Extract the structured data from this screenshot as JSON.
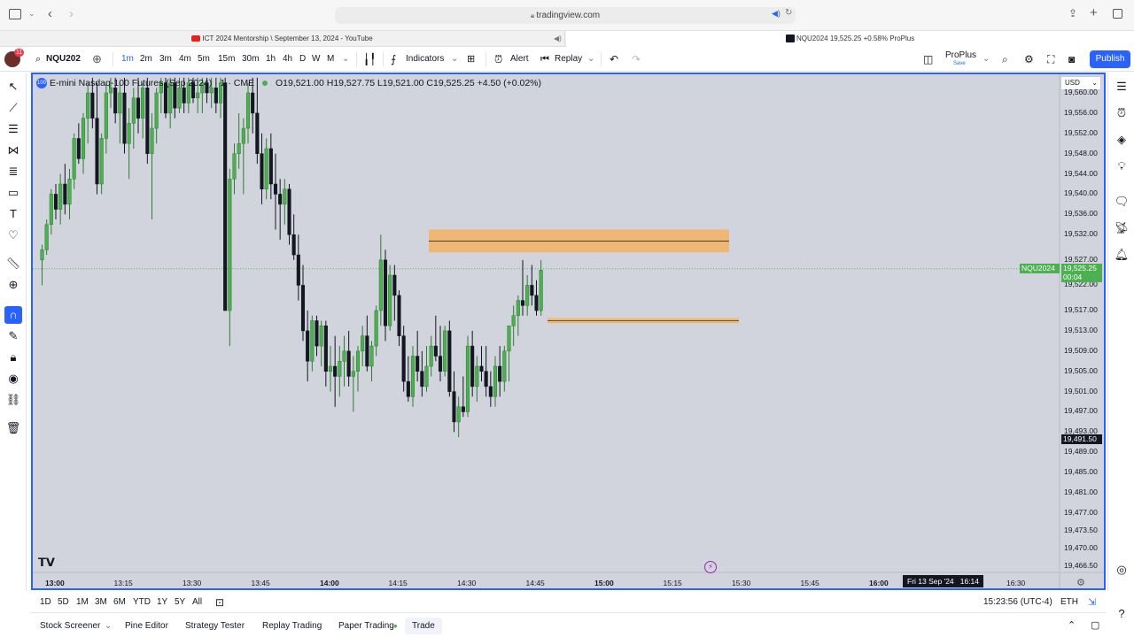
{
  "browser": {
    "url": "tradingview.com",
    "tabs": [
      {
        "label": "ICT 2024 Mentorship \\ September 13, 2024 - YouTube"
      },
      {
        "label": "NQU2024 19,525.25 +0.58% ProPlus"
      }
    ]
  },
  "toolbar": {
    "symbol": "NQU202",
    "avatar_badge": "11",
    "intervals": [
      "1m",
      "2m",
      "3m",
      "4m",
      "5m",
      "15m",
      "30m",
      "1h",
      "4h",
      "D",
      "W",
      "M"
    ],
    "indicators_label": "Indicators",
    "alert_label": "Alert",
    "replay_label": "Replay",
    "plan_label": "ProPlus",
    "plan_sub": "Save",
    "publish_label": "Publish"
  },
  "legend": {
    "title": "E-mini Nasdaq-100 Futures (Sep 2024) · 1 · CME",
    "ohlc": "O19,521.00 H19,527.75 L19,521.00 C19,525.25 +4.50 (+0.02%)"
  },
  "price_axis": {
    "currency": "USD",
    "ticks": [
      "19,560.00",
      "19,556.00",
      "19,552.00",
      "19,548.00",
      "19,544.00",
      "19,540.00",
      "19,536.00",
      "19,532.00",
      "19,527.00",
      "19,522.00",
      "19,517.00",
      "19,513.00",
      "19,509.00",
      "19,505.00",
      "19,501.00",
      "19,497.00",
      "19,493.00",
      "19,489.00",
      "19,485.00",
      "19,481.00",
      "19,477.00",
      "19,473.50",
      "19,470.00",
      "19,466.50"
    ],
    "symbol_tag": "NQU2024",
    "last_price": "19,525.25",
    "countdown": "00:04",
    "crosshair_price": "19,491.50"
  },
  "time_axis": {
    "ticks": [
      "13:00",
      "13:15",
      "13:30",
      "13:45",
      "14:00",
      "14:15",
      "14:30",
      "14:45",
      "15:00",
      "15:15",
      "15:30",
      "15:45",
      "16:00",
      "16:30"
    ],
    "crosshair_time": "Fri 13 Sep '24   16:14"
  },
  "ranges": {
    "items": [
      "1D",
      "5D",
      "1M",
      "3M",
      "6M",
      "YTD",
      "1Y",
      "5Y",
      "All"
    ],
    "clock": "15:23:56 (UTC-4)",
    "session": "ETH"
  },
  "panels": {
    "items": [
      "Stock Screener",
      "Pine Editor",
      "Strategy Tester",
      "Replay Trading",
      "Paper Trading",
      "Trade"
    ]
  },
  "colors": {
    "up": "#4caf50",
    "down": "#131722",
    "zone": "#f5b162",
    "accent": "#2962ff"
  },
  "chart_data": {
    "type": "candlestick",
    "symbol": "NQU2024",
    "interval": "1",
    "zones": [
      {
        "from": 19528.5,
        "to": 19533.0
      },
      {
        "from": 19514.5,
        "to": 19515.5
      }
    ],
    "candles": [
      [
        19527,
        19530,
        19522,
        19529
      ],
      [
        19529,
        19535,
        19528,
        19534
      ],
      [
        19534,
        19541,
        19532,
        19540
      ],
      [
        19540,
        19542,
        19535,
        19537
      ],
      [
        19537,
        19544,
        19534,
        19542
      ],
      [
        19542,
        19546,
        19536,
        19538
      ],
      [
        19538,
        19545,
        19535,
        19543
      ],
      [
        19543,
        19552,
        19541,
        19551
      ],
      [
        19551,
        19554,
        19546,
        19547
      ],
      [
        19547,
        19556,
        19544,
        19555
      ],
      [
        19555,
        19562,
        19550,
        19560
      ],
      [
        19560,
        19563,
        19553,
        19555
      ],
      [
        19555,
        19562,
        19540,
        19542
      ],
      [
        19542,
        19552,
        19540,
        19551
      ],
      [
        19551,
        19562,
        19548,
        19560
      ],
      [
        19560,
        19563,
        19557,
        19561
      ],
      [
        19561,
        19563,
        19554,
        19556
      ],
      [
        19556,
        19562,
        19550,
        19560
      ],
      [
        19560,
        19563,
        19548,
        19550
      ],
      [
        19550,
        19557,
        19543,
        19554
      ],
      [
        19554,
        19561,
        19549,
        19559
      ],
      [
        19559,
        19563,
        19552,
        19555
      ],
      [
        19555,
        19562,
        19551,
        19561
      ],
      [
        19561,
        19563,
        19546,
        19548
      ],
      [
        19548,
        19556,
        19535,
        19553
      ],
      [
        19553,
        19561,
        19550,
        19560
      ],
      [
        19560,
        19563,
        19556,
        19562
      ],
      [
        19562,
        19563,
        19555,
        19556
      ],
      [
        19556,
        19563,
        19553,
        19562
      ],
      [
        19562,
        19563,
        19555,
        19557
      ],
      [
        19557,
        19563,
        19556,
        19561
      ],
      [
        19561,
        19563,
        19556,
        19558
      ],
      [
        19558,
        19563,
        19556,
        19562
      ],
      [
        19562,
        19563,
        19558,
        19559
      ],
      [
        19559,
        19563,
        19556,
        19560
      ],
      [
        19560,
        19563,
        19556,
        19562
      ],
      [
        19562,
        19563,
        19558,
        19560
      ],
      [
        19560,
        19563,
        19557,
        19561
      ],
      [
        19561,
        19563,
        19556,
        19558
      ],
      [
        19558,
        19563,
        19555,
        19562
      ],
      [
        19562,
        19563,
        19546,
        19517
      ],
      [
        19517,
        19545,
        19510,
        19543
      ],
      [
        19543,
        19550,
        19540,
        19548
      ],
      [
        19548,
        19556,
        19545,
        19550
      ],
      [
        19550,
        19555,
        19540,
        19553
      ],
      [
        19553,
        19562,
        19550,
        19560
      ],
      [
        19560,
        19563,
        19552,
        19556
      ],
      [
        19556,
        19563,
        19546,
        19548
      ],
      [
        19548,
        19552,
        19538,
        19541
      ],
      [
        19541,
        19551,
        19539,
        19549
      ],
      [
        19549,
        19552,
        19539,
        19542
      ],
      [
        19542,
        19548,
        19533,
        19540
      ],
      [
        19540,
        19543,
        19531,
        19538
      ],
      [
        19538,
        19543,
        19534,
        19541
      ],
      [
        19541,
        19542,
        19530,
        19532
      ],
      [
        19532,
        19536,
        19527,
        19528
      ],
      [
        19528,
        19532,
        19519,
        19522
      ],
      [
        19522,
        19526,
        19511,
        19513
      ],
      [
        19513,
        19517,
        19503,
        19507
      ],
      [
        19507,
        19516,
        19505,
        19515
      ],
      [
        19515,
        19516,
        19508,
        19510
      ],
      [
        19510,
        19515,
        19506,
        19514
      ],
      [
        19514,
        19515,
        19502,
        19505
      ],
      [
        19505,
        19510,
        19501,
        19506
      ],
      [
        19506,
        19512,
        19498,
        19504
      ],
      [
        19504,
        19510,
        19500,
        19507
      ],
      [
        19507,
        19512,
        19502,
        19509
      ],
      [
        19509,
        19513,
        19502,
        19504
      ],
      [
        19504,
        19508,
        19497,
        19505
      ],
      [
        19505,
        19510,
        19501,
        19509
      ],
      [
        19509,
        19514,
        19506,
        19512
      ],
      [
        19512,
        19516,
        19505,
        19506
      ],
      [
        19506,
        19511,
        19503,
        19510
      ],
      [
        19510,
        19518,
        19508,
        19517
      ],
      [
        19517,
        19532,
        19514,
        19527
      ],
      [
        19527,
        19529,
        19511,
        19514
      ],
      [
        19514,
        19526,
        19513,
        19524
      ],
      [
        19524,
        19526,
        19515,
        19520
      ],
      [
        19520,
        19521,
        19510,
        19512
      ],
      [
        19512,
        19514,
        19501,
        19503
      ],
      [
        19503,
        19508,
        19499,
        19500
      ],
      [
        19500,
        19510,
        19498,
        19508
      ],
      [
        19508,
        19513,
        19503,
        19505
      ],
      [
        19505,
        19509,
        19500,
        19502
      ],
      [
        19502,
        19510,
        19501,
        19506
      ],
      [
        19506,
        19512,
        19504,
        19510
      ],
      [
        19510,
        19516,
        19507,
        19508
      ],
      [
        19508,
        19514,
        19503,
        19505
      ],
      [
        19505,
        19514,
        19504,
        19513
      ],
      [
        19513,
        19515,
        19500,
        19501
      ],
      [
        19501,
        19505,
        19493,
        19495
      ],
      [
        19495,
        19500,
        19492,
        19498
      ],
      [
        19498,
        19504,
        19496,
        19497
      ],
      [
        19497,
        19512,
        19496,
        19510
      ],
      [
        19510,
        19513,
        19500,
        19502
      ],
      [
        19502,
        19508,
        19499,
        19506
      ],
      [
        19506,
        19510,
        19503,
        19505
      ],
      [
        19505,
        19510,
        19500,
        19502
      ],
      [
        19502,
        19505,
        19498,
        19500
      ],
      [
        19500,
        19508,
        19498,
        19506
      ],
      [
        19506,
        19510,
        19500,
        19503
      ],
      [
        19503,
        19510,
        19501,
        19509
      ],
      [
        19509,
        19513,
        19503,
        19514
      ],
      [
        19514,
        19518,
        19510,
        19516
      ],
      [
        19516,
        19520,
        19512,
        19519
      ],
      [
        19519,
        19527,
        19516,
        19518
      ],
      [
        19518,
        19524,
        19516,
        19522
      ],
      [
        19522,
        19526,
        19518,
        19520
      ],
      [
        19520,
        19523,
        19516,
        19517
      ],
      [
        19517,
        19527,
        19516,
        19525
      ]
    ]
  }
}
